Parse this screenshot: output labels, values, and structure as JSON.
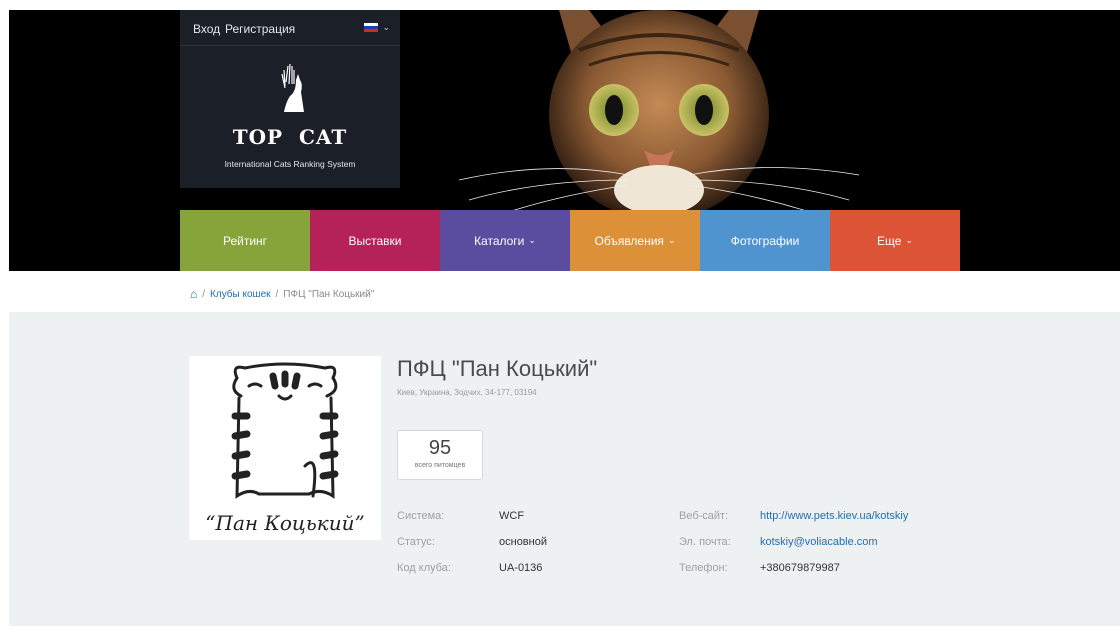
{
  "auth": {
    "login": "Вход",
    "register": "Регистрация"
  },
  "lang": {
    "flag_colors": [
      "#ffffff",
      "#1c3fa8",
      "#d52b1e"
    ]
  },
  "logo": {
    "title_left": "TOP",
    "title_right": "CAT",
    "subtitle": "International Cats Ranking System"
  },
  "menu": [
    {
      "label": "Рейтинг",
      "dropdown": false
    },
    {
      "label": "Выставки",
      "dropdown": false
    },
    {
      "label": "Каталоги",
      "dropdown": true
    },
    {
      "label": "Объявления",
      "dropdown": true
    },
    {
      "label": "Фотографии",
      "dropdown": false
    },
    {
      "label": "Еще",
      "dropdown": true
    }
  ],
  "breadcrumb": {
    "home_icon": "home-icon",
    "sep": "/",
    "clubs": "Клубы кошек",
    "current": "ПФЦ \"Пан Коцький\""
  },
  "club": {
    "name": "ПФЦ \"Пан Коцький\"",
    "address": "Киев, Украина, Зодчих, 34-177, 03194",
    "logo_caption": "“Пан Коцький”",
    "pets_count": "95",
    "pets_label": "всего питомцев",
    "system_label": "Система:",
    "system": "WCF",
    "status_label": "Статус:",
    "status": "основной",
    "code_label": "Код клуба:",
    "code": "UA-0136",
    "website_label": "Веб-сайт:",
    "website": "http://www.pets.kiev.ua/kotskiy",
    "email_label": "Эл. почта:",
    "email": "kotskiy@voliacable.com",
    "phone_label": "Телефон:",
    "phone": "+380679879987"
  },
  "colors": {
    "rating": "#86a43a",
    "shows": "#b5225a",
    "catalogs": "#5a4c9e",
    "ads": "#dc9038",
    "photos": "#4f93cf",
    "more": "#dc5336",
    "link": "#1f6fb4"
  }
}
